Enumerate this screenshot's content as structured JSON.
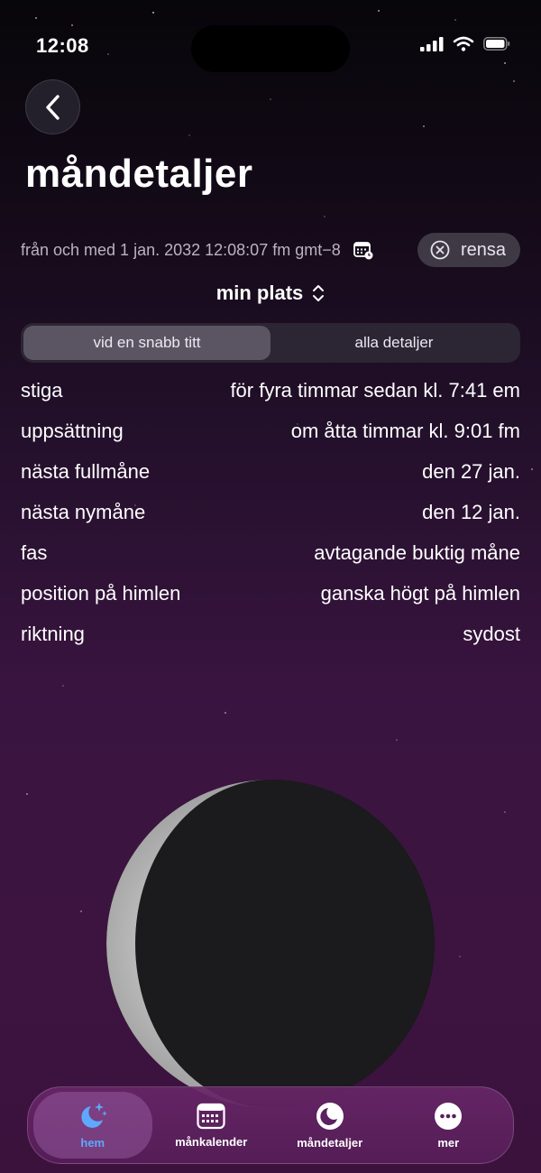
{
  "status": {
    "time": "12:08"
  },
  "header": {
    "title": "måndetaljer"
  },
  "date": {
    "text": "från och med 1 jan. 2032 12:08:07 fm gmt−8",
    "clear_label": "rensa"
  },
  "location": {
    "label": "min plats"
  },
  "segments": [
    {
      "label": "vid en snabb titt",
      "active": true
    },
    {
      "label": "alla detaljer",
      "active": false
    }
  ],
  "details": [
    {
      "label": "stiga",
      "value": "för fyra timmar sedan kl. 7:41 em"
    },
    {
      "label": "uppsättning",
      "value": "om åtta timmar kl. 9:01 fm"
    },
    {
      "label": "nästa fullmåne",
      "value": "den 27 jan."
    },
    {
      "label": "nästa nymåne",
      "value": "den 12 jan."
    },
    {
      "label": "fas",
      "value": "avtagande buktig måne"
    },
    {
      "label": "position på himlen",
      "value": "ganska högt på himlen"
    },
    {
      "label": "riktning",
      "value": "sydost"
    }
  ],
  "tabs": [
    {
      "label": "hem",
      "icon": "moon-stars-icon",
      "active": true
    },
    {
      "label": "månkalender",
      "icon": "calendar-icon",
      "active": false
    },
    {
      "label": "måndetaljer",
      "icon": "moon-circle-icon",
      "active": false
    },
    {
      "label": "mer",
      "icon": "ellipsis-icon",
      "active": false
    }
  ],
  "colors": {
    "accent": "#5ea8ff",
    "background_top": "#07060a",
    "background_bottom": "#3a123c"
  }
}
